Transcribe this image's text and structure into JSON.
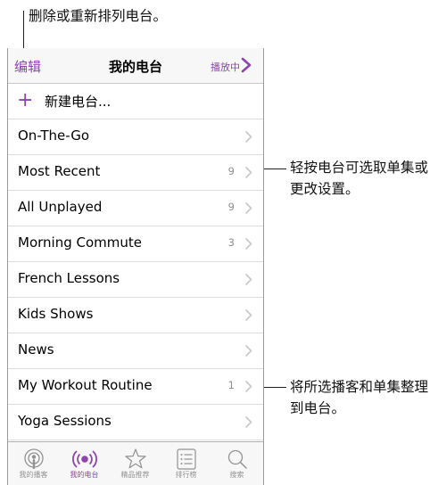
{
  "callouts": {
    "top": "删除或重新排列电台。",
    "right1": "轻按电台可选取单集或更改设置。",
    "right2": "将所选播客和单集整理到电台。"
  },
  "nav": {
    "edit": "编辑",
    "title": "我的电台",
    "now_playing": "播放中"
  },
  "new_station": "新建电台...",
  "stations": [
    {
      "label": "On-The-Go",
      "count": ""
    },
    {
      "label": "Most Recent",
      "count": "9"
    },
    {
      "label": "All Unplayed",
      "count": "9"
    },
    {
      "label": "Morning Commute",
      "count": "3"
    },
    {
      "label": "French Lessons",
      "count": ""
    },
    {
      "label": "Kids Shows",
      "count": ""
    },
    {
      "label": "News",
      "count": ""
    },
    {
      "label": "My Workout Routine",
      "count": "1"
    },
    {
      "label": "Yoga Sessions",
      "count": ""
    }
  ],
  "tabs": [
    {
      "label": "我的播客",
      "icon": "podcast-icon"
    },
    {
      "label": "我的电台",
      "icon": "broadcast-icon"
    },
    {
      "label": "精品推荐",
      "icon": "star-icon"
    },
    {
      "label": "排行榜",
      "icon": "list-icon"
    },
    {
      "label": "搜索",
      "icon": "search-icon"
    }
  ],
  "colors": {
    "accent": "#8e44ad"
  }
}
